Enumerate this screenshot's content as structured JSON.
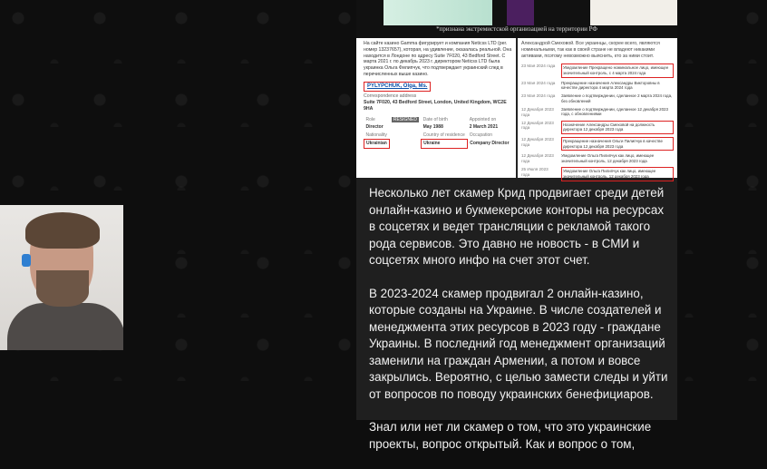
{
  "banner": {
    "caption": "*признана экстремистской организацией на территории РФ"
  },
  "doc_left": {
    "intro": "На сайте казино Gamma фигурирует и компания Neticss LTD (рег. номер 13237657), которая, на удивление, оказалась реальной. Она находится в Лондоне по адресу Suite 7F020, 43 Bedford Street. С марта 2021 г. по декабрь 2023 г. директором Neticss LTD была украинка Ольга Филипчук, что подтверждает украинский след в перечисленных выше казино.",
    "name": "PYLYPCHUK, Olga, Ms.",
    "corr_label": "Correspondence address",
    "address": "Suite 7F020, 43 Bedford Street, London, United Kingdom, WC2E 9HA",
    "role_label": "Role",
    "role_value": "Director",
    "status_badge": "RESIGNED",
    "dob_label": "Date of birth",
    "dob_value": "May 1988",
    "appointed_label": "Appointed on",
    "appointed_value": "2 March 2021",
    "nationality_label": "Nationality",
    "nationality_value": "Ukrainian",
    "country_label": "Country of residence",
    "country_value": "Ukraine",
    "occupation_label": "Occupation",
    "occupation_value": "Company Director"
  },
  "doc_right": {
    "intro": "Александрой Смеховой. Все украинцы, скорее всего, являются номинальными, так как в своей стране не владеют никакими активами, поэтому невозможно выяснить, кто за ними стоит.",
    "timeline": [
      {
        "date": "23 Мая 2024 года",
        "text": "Уведомление Прекращено номинальное лицо, имеющее значительный контроль, с 4 марта 2024 года",
        "red": true
      },
      {
        "date": "23 Мая 2024 года",
        "text": "Прекращение назначения Александры Викторовны в качестве директора 4 марта 2024 года",
        "red": false
      },
      {
        "date": "23 Мая 2024 года",
        "text": "Заявление о подтверждении, сделанное 2 марта 2024 года, без обновлений",
        "red": false
      },
      {
        "date": "12 Декабря 2023 года",
        "text": "Заявление о подтверждении, сделанное 12 декабря 2023 года, с обновлениями",
        "red": false
      },
      {
        "date": "12 Декабря 2023 года",
        "text": "Назначение Александры Смеховой на должность директора 12 декабря 2023 года",
        "red": true
      },
      {
        "date": "12 Декабря 2023 года",
        "text": "Прекращение назначения Ольги Пилипчук в качестве директора 12 декабря 2023 года",
        "red": true
      },
      {
        "date": "12 Декабря 2023 года",
        "text": "Уведомление Ольга Пилипчук как лицо, имеющее значительный контроль, 12 декабря 2023 года",
        "red": false
      },
      {
        "date": "25 Июля 2023 года",
        "text": "Уведомление Ольга Пилипчук как лицо, имеющее значительный контроль, 12 декабря 2023 года",
        "red": true
      }
    ]
  },
  "post": {
    "paragraphs": [
      "Несколько лет скамер Крид продвигает среди детей онлайн-казино и букмекерские конторы на ресурсах в соцсетях и ведет трансляции с рекламой такого рода сервисов. Это давно не новость - в СМИ и соцсетях много инфо на счет этот счет.",
      "В 2023-2024 скамер продвигал 2 онлайн-казино, которые созданы на Украине. В числе создателей и менеджмента этих ресурсов в 2023 году - граждане Украины. В последний год менеджмент организаций заменили на граждан Армении, а потом и вовсе закрылись. Вероятно, с целью замести следы и уйти от вопросов по поводу украинских бенефициаров.",
      "Знал или нет ли скамер о том, что это украинские проекты, вопрос открытый. Как и вопрос о том,"
    ]
  },
  "colors": {
    "page_bg": "#0e0e0e",
    "post_bg": "#1f1f1f",
    "highlight_red": "#d22222",
    "link_blue": "#0b4fa8"
  }
}
